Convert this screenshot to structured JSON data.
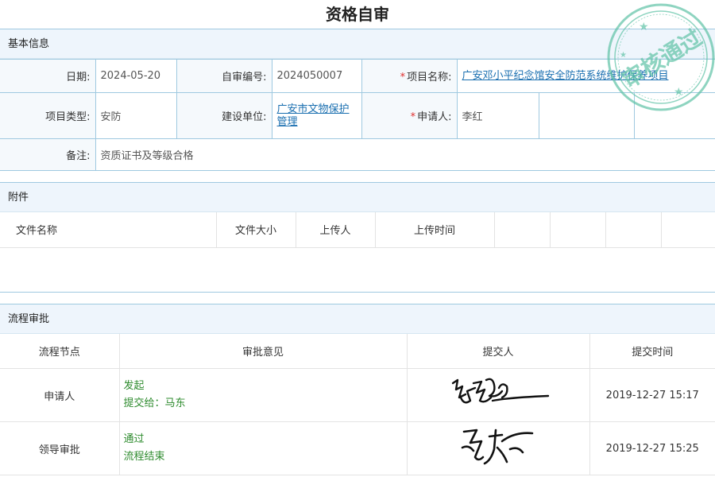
{
  "page": {
    "title": "资格自审"
  },
  "basic": {
    "header": "基本信息",
    "date_label": "日期:",
    "date_value": "2024-05-20",
    "code_label": "自审编号:",
    "code_value": "2024050007",
    "project_name_label": "项目名称:",
    "project_name_value": "广安邓小平纪念馆安全防范系统维护保养项目",
    "project_type_label": "项目类型:",
    "project_type_value": "安防",
    "builder_label": "建设单位:",
    "builder_value": "广安市文物保护管理",
    "applicant_label": "申请人:",
    "applicant_value": "李红",
    "remark_label": "备注:",
    "remark_value": "资质证书及等级合格",
    "required_mark": "*"
  },
  "attachments": {
    "header": "附件",
    "columns": [
      "文件名称",
      "文件大小",
      "上传人",
      "上传时间"
    ]
  },
  "flow": {
    "header": "流程审批",
    "columns": [
      "流程节点",
      "审批意见",
      "提交人",
      "提交时间"
    ],
    "rows": [
      {
        "node": "申请人",
        "opinion": [
          "发起",
          "提交给：马东"
        ],
        "time": "2019-12-27 15:17"
      },
      {
        "node": "领导审批",
        "opinion": [
          "通过",
          "流程结束"
        ],
        "time": "2019-12-27 15:25"
      }
    ]
  },
  "stamp": {
    "text": "审核通过",
    "color": "#5fc3a6"
  },
  "colors": {
    "border": "#9fc9e0",
    "link": "#1a6fb0",
    "required": "#e0302f",
    "opinion": "#2e8b2e"
  }
}
